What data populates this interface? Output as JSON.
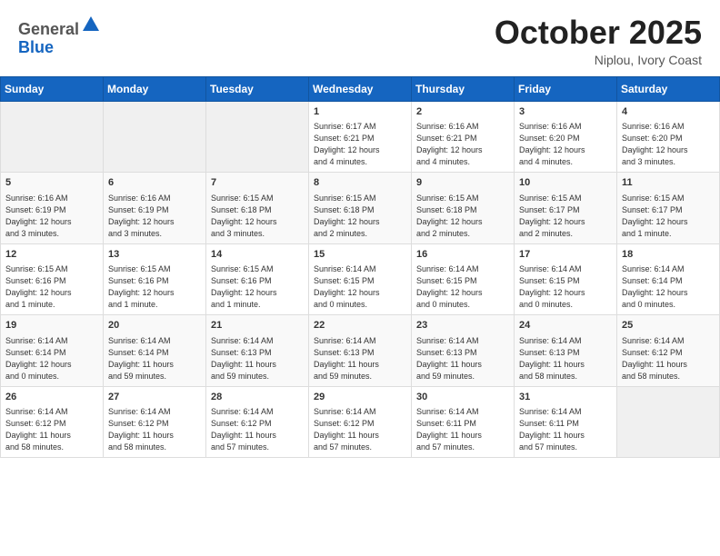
{
  "header": {
    "logo_line1": "General",
    "logo_line2": "Blue",
    "month": "October 2025",
    "location": "Niplou, Ivory Coast"
  },
  "days_of_week": [
    "Sunday",
    "Monday",
    "Tuesday",
    "Wednesday",
    "Thursday",
    "Friday",
    "Saturday"
  ],
  "weeks": [
    [
      {
        "day": "",
        "info": ""
      },
      {
        "day": "",
        "info": ""
      },
      {
        "day": "",
        "info": ""
      },
      {
        "day": "1",
        "info": "Sunrise: 6:17 AM\nSunset: 6:21 PM\nDaylight: 12 hours\nand 4 minutes."
      },
      {
        "day": "2",
        "info": "Sunrise: 6:16 AM\nSunset: 6:21 PM\nDaylight: 12 hours\nand 4 minutes."
      },
      {
        "day": "3",
        "info": "Sunrise: 6:16 AM\nSunset: 6:20 PM\nDaylight: 12 hours\nand 4 minutes."
      },
      {
        "day": "4",
        "info": "Sunrise: 6:16 AM\nSunset: 6:20 PM\nDaylight: 12 hours\nand 3 minutes."
      }
    ],
    [
      {
        "day": "5",
        "info": "Sunrise: 6:16 AM\nSunset: 6:19 PM\nDaylight: 12 hours\nand 3 minutes."
      },
      {
        "day": "6",
        "info": "Sunrise: 6:16 AM\nSunset: 6:19 PM\nDaylight: 12 hours\nand 3 minutes."
      },
      {
        "day": "7",
        "info": "Sunrise: 6:15 AM\nSunset: 6:18 PM\nDaylight: 12 hours\nand 3 minutes."
      },
      {
        "day": "8",
        "info": "Sunrise: 6:15 AM\nSunset: 6:18 PM\nDaylight: 12 hours\nand 2 minutes."
      },
      {
        "day": "9",
        "info": "Sunrise: 6:15 AM\nSunset: 6:18 PM\nDaylight: 12 hours\nand 2 minutes."
      },
      {
        "day": "10",
        "info": "Sunrise: 6:15 AM\nSunset: 6:17 PM\nDaylight: 12 hours\nand 2 minutes."
      },
      {
        "day": "11",
        "info": "Sunrise: 6:15 AM\nSunset: 6:17 PM\nDaylight: 12 hours\nand 1 minute."
      }
    ],
    [
      {
        "day": "12",
        "info": "Sunrise: 6:15 AM\nSunset: 6:16 PM\nDaylight: 12 hours\nand 1 minute."
      },
      {
        "day": "13",
        "info": "Sunrise: 6:15 AM\nSunset: 6:16 PM\nDaylight: 12 hours\nand 1 minute."
      },
      {
        "day": "14",
        "info": "Sunrise: 6:15 AM\nSunset: 6:16 PM\nDaylight: 12 hours\nand 1 minute."
      },
      {
        "day": "15",
        "info": "Sunrise: 6:14 AM\nSunset: 6:15 PM\nDaylight: 12 hours\nand 0 minutes."
      },
      {
        "day": "16",
        "info": "Sunrise: 6:14 AM\nSunset: 6:15 PM\nDaylight: 12 hours\nand 0 minutes."
      },
      {
        "day": "17",
        "info": "Sunrise: 6:14 AM\nSunset: 6:15 PM\nDaylight: 12 hours\nand 0 minutes."
      },
      {
        "day": "18",
        "info": "Sunrise: 6:14 AM\nSunset: 6:14 PM\nDaylight: 12 hours\nand 0 minutes."
      }
    ],
    [
      {
        "day": "19",
        "info": "Sunrise: 6:14 AM\nSunset: 6:14 PM\nDaylight: 12 hours\nand 0 minutes."
      },
      {
        "day": "20",
        "info": "Sunrise: 6:14 AM\nSunset: 6:14 PM\nDaylight: 11 hours\nand 59 minutes."
      },
      {
        "day": "21",
        "info": "Sunrise: 6:14 AM\nSunset: 6:13 PM\nDaylight: 11 hours\nand 59 minutes."
      },
      {
        "day": "22",
        "info": "Sunrise: 6:14 AM\nSunset: 6:13 PM\nDaylight: 11 hours\nand 59 minutes."
      },
      {
        "day": "23",
        "info": "Sunrise: 6:14 AM\nSunset: 6:13 PM\nDaylight: 11 hours\nand 59 minutes."
      },
      {
        "day": "24",
        "info": "Sunrise: 6:14 AM\nSunset: 6:13 PM\nDaylight: 11 hours\nand 58 minutes."
      },
      {
        "day": "25",
        "info": "Sunrise: 6:14 AM\nSunset: 6:12 PM\nDaylight: 11 hours\nand 58 minutes."
      }
    ],
    [
      {
        "day": "26",
        "info": "Sunrise: 6:14 AM\nSunset: 6:12 PM\nDaylight: 11 hours\nand 58 minutes."
      },
      {
        "day": "27",
        "info": "Sunrise: 6:14 AM\nSunset: 6:12 PM\nDaylight: 11 hours\nand 58 minutes."
      },
      {
        "day": "28",
        "info": "Sunrise: 6:14 AM\nSunset: 6:12 PM\nDaylight: 11 hours\nand 57 minutes."
      },
      {
        "day": "29",
        "info": "Sunrise: 6:14 AM\nSunset: 6:12 PM\nDaylight: 11 hours\nand 57 minutes."
      },
      {
        "day": "30",
        "info": "Sunrise: 6:14 AM\nSunset: 6:11 PM\nDaylight: 11 hours\nand 57 minutes."
      },
      {
        "day": "31",
        "info": "Sunrise: 6:14 AM\nSunset: 6:11 PM\nDaylight: 11 hours\nand 57 minutes."
      },
      {
        "day": "",
        "info": ""
      }
    ]
  ]
}
